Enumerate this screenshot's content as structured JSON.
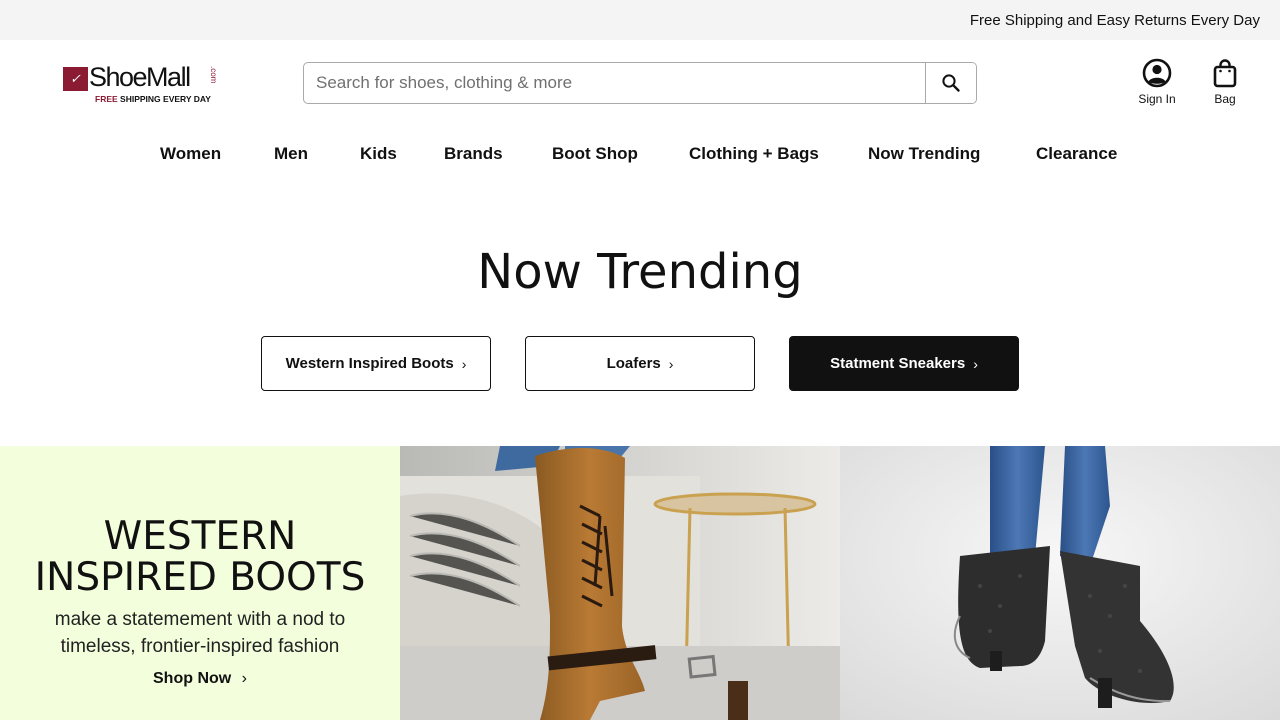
{
  "promo": {
    "text": "Free Shipping and Easy Returns Every Day"
  },
  "header": {
    "logo": {
      "brand": "ShoeMall",
      "suffix": ".com",
      "tag_free": "FREE",
      "tag_rest": "SHIPPING EVERY DAY"
    },
    "search": {
      "placeholder": "Search for shoes, clothing & more",
      "value": ""
    },
    "account_label": "Sign In",
    "bag_label": "Bag"
  },
  "nav": {
    "items": [
      {
        "label": "Women"
      },
      {
        "label": "Men"
      },
      {
        "label": "Kids"
      },
      {
        "label": "Brands"
      },
      {
        "label": "Boot Shop"
      },
      {
        "label": "Clothing + Bags"
      },
      {
        "label": "Now Trending"
      },
      {
        "label": "Clearance"
      }
    ]
  },
  "trending": {
    "title": "Now Trending",
    "chips": [
      {
        "label": "Western Inspired Boots",
        "style": "outline"
      },
      {
        "label": "Loafers",
        "style": "outline"
      },
      {
        "label": "Statment Sneakers",
        "style": "dark"
      }
    ]
  },
  "hero": {
    "title_line1": "WESTERN",
    "title_line2": "INSPIRED BOOTS",
    "subtitle": "make a statemement with a nod to timeless, frontier-inspired fashion",
    "cta": "Shop Now",
    "background": "#f3fedc"
  },
  "colors": {
    "brand": "#8b1a33",
    "text": "#111111",
    "promo_bg": "#f4f4f4"
  },
  "icons": {
    "search": "search-icon",
    "account": "user-circle-icon",
    "bag": "shopping-bag-icon",
    "chevron": "chevron-right-icon"
  }
}
